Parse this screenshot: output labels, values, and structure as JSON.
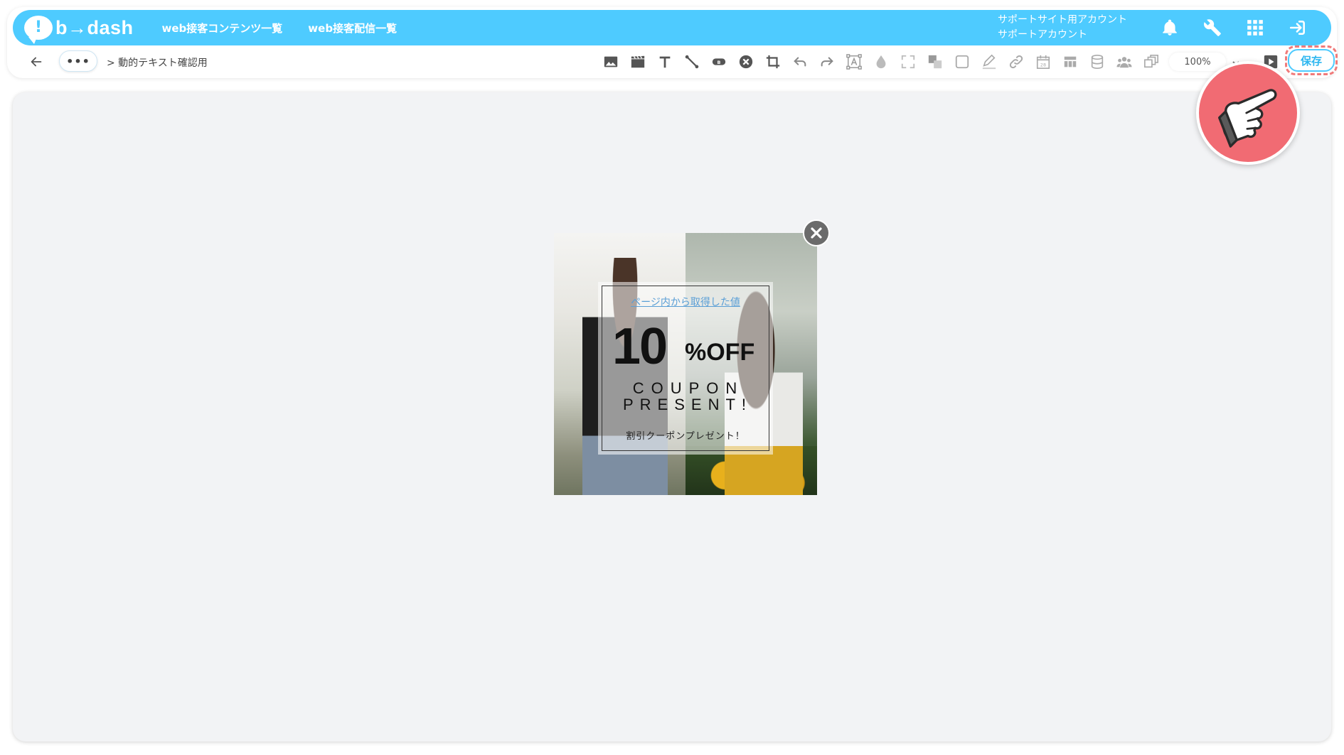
{
  "brand": {
    "logo_text": "b→dash",
    "logo_mark": "!"
  },
  "nav": {
    "items": [
      {
        "label": "web接客コンテンツ一覧"
      },
      {
        "label": "web接客配信一覧"
      }
    ]
  },
  "account": {
    "line1": "サポートサイト用アカウント",
    "line2": "サポートアカウント"
  },
  "header_icons": [
    "bell-icon",
    "wrench-icon",
    "grid-icon",
    "logout-icon"
  ],
  "breadcrumb": {
    "more": "•••",
    "current": "> 動的テキスト確認用"
  },
  "toolbar": {
    "tools": [
      "image-icon",
      "video-icon",
      "text-icon",
      "line-icon",
      "button-icon",
      "close-element-icon",
      "crop-icon",
      "undo-icon",
      "redo-icon",
      "text-box-icon",
      "opacity-icon",
      "fullscreen-icon",
      "layer-icon",
      "border-icon",
      "pen-icon",
      "link-icon",
      "calendar-icon",
      "table-icon",
      "database-icon",
      "users-icon",
      "copy-icon"
    ],
    "zoom": "100%",
    "save_label": "保存"
  },
  "popup": {
    "link_text": "ページ内から取得した値",
    "number": "10",
    "off_text": "%OFF",
    "line1": "COUPON",
    "line2": "PRESENT!",
    "subtitle": "割引クーポンプレゼント！"
  },
  "colors": {
    "brand": "#4ecbff",
    "highlight": "#f07a7a",
    "pointer_badge": "#f16b73",
    "link": "#5a9fd6"
  }
}
